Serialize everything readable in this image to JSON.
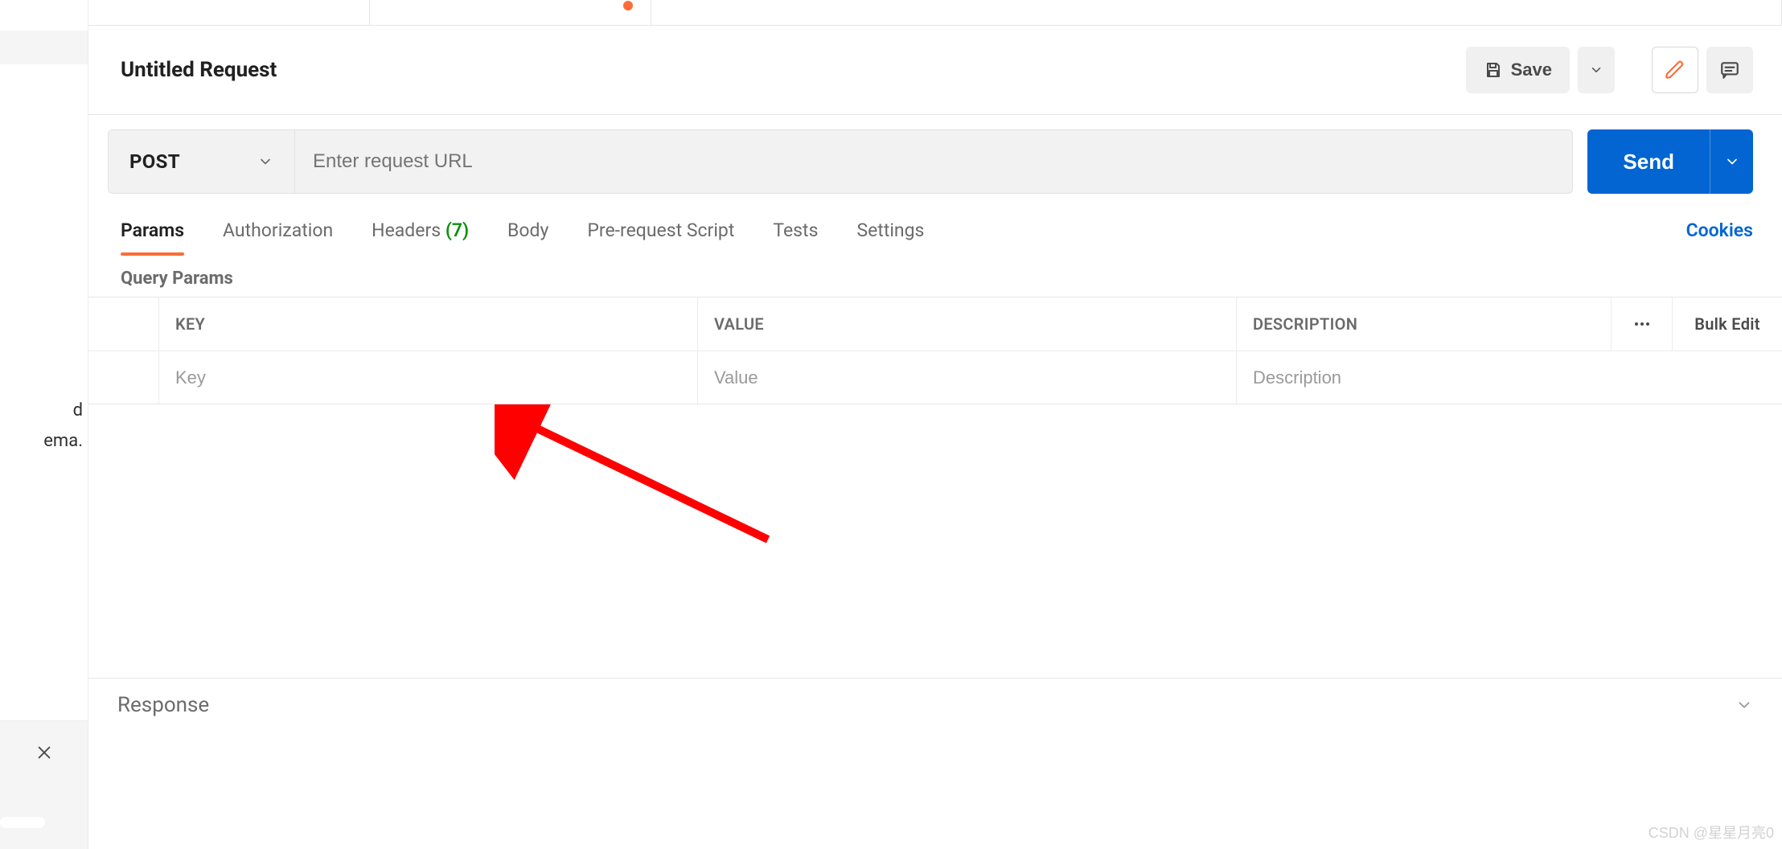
{
  "sidebar": {
    "frag1": "d",
    "frag2": "ema."
  },
  "request": {
    "title": "Untitled Request",
    "save_label": "Save",
    "method": "POST",
    "url_placeholder": "Enter request URL",
    "send_label": "Send"
  },
  "reqtabs": {
    "params": "Params",
    "authorization": "Authorization",
    "headers": "Headers",
    "headers_count": "(7)",
    "body": "Body",
    "prerequest": "Pre-request Script",
    "tests": "Tests",
    "settings": "Settings",
    "cookies": "Cookies"
  },
  "params": {
    "section_label": "Query Params",
    "col_key": "KEY",
    "col_value": "VALUE",
    "col_desc": "DESCRIPTION",
    "bulk_edit": "Bulk Edit",
    "ph_key": "Key",
    "ph_value": "Value",
    "ph_desc": "Description"
  },
  "response": {
    "label": "Response"
  },
  "watermark": "CSDN @星星月亮0"
}
